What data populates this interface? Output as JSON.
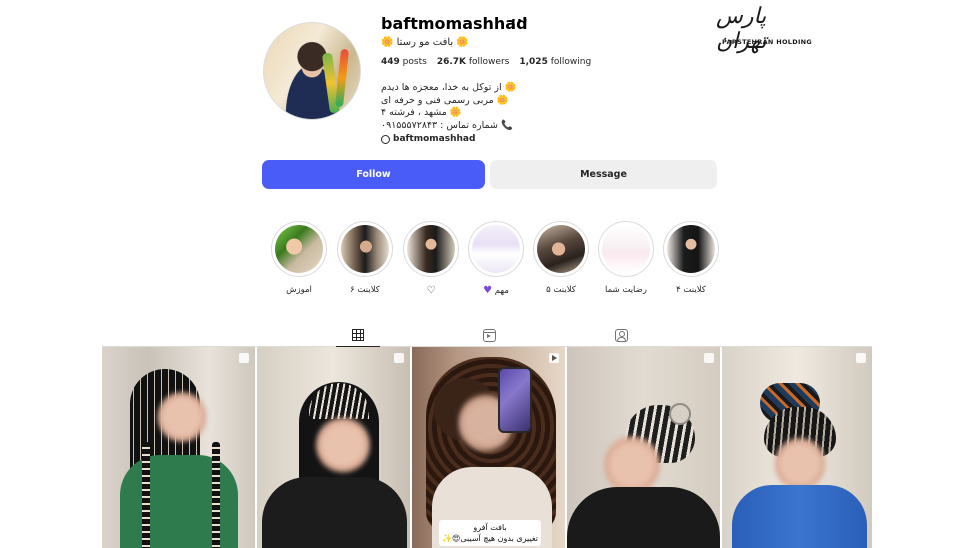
{
  "profile": {
    "username": "baftmomashhad",
    "more_icon": "more-horizontal-icon",
    "display_name": "🌼 بافت مو رستا 🌼",
    "stats": {
      "posts_count": "449",
      "posts_label": "posts",
      "followers_count": "26.7K",
      "followers_label": "followers",
      "following_count": "1,025",
      "following_label": "following"
    },
    "bio": [
      "🌼 از توکل به خدا، معجزه ها دیدم",
      "🌼 مربی رسمی فنی و حرفه ای",
      "🌼 مشهد ، فرشته ۴",
      "📞 شماره تماس : ۰۹۱۵۵۵۷۲۸۴۳"
    ],
    "threads_handle": "baftmomashhad"
  },
  "watermark": {
    "script_text": "پارس تهران",
    "sub_text": "PARSTEHRAN HOLDING"
  },
  "actions": {
    "follow_label": "Follow",
    "message_label": "Message",
    "follow_color": "#4a5cf8"
  },
  "highlights": [
    {
      "label": "اموزش"
    },
    {
      "label": "کلاینت ۶"
    },
    {
      "label": "",
      "icon": "heart-outline-icon"
    },
    {
      "label": "مهم",
      "icon": "purple-heart-icon"
    },
    {
      "label": "کلاینت ۵"
    },
    {
      "label": "رضایت شما"
    },
    {
      "label": "کلاینت ۴"
    }
  ],
  "tabs": [
    {
      "name": "posts",
      "icon": "grid-icon",
      "active": true
    },
    {
      "name": "reels",
      "icon": "reels-icon",
      "active": false
    },
    {
      "name": "tagged",
      "icon": "tagged-icon",
      "active": false
    }
  ],
  "posts": [
    {
      "type": "carousel"
    },
    {
      "type": "carousel"
    },
    {
      "type": "video",
      "caption_line1": "بافت آفرو",
      "caption_line2": "تغییری بدون هیچ آسیبی😍✨"
    },
    {
      "type": "carousel"
    },
    {
      "type": "carousel"
    }
  ]
}
